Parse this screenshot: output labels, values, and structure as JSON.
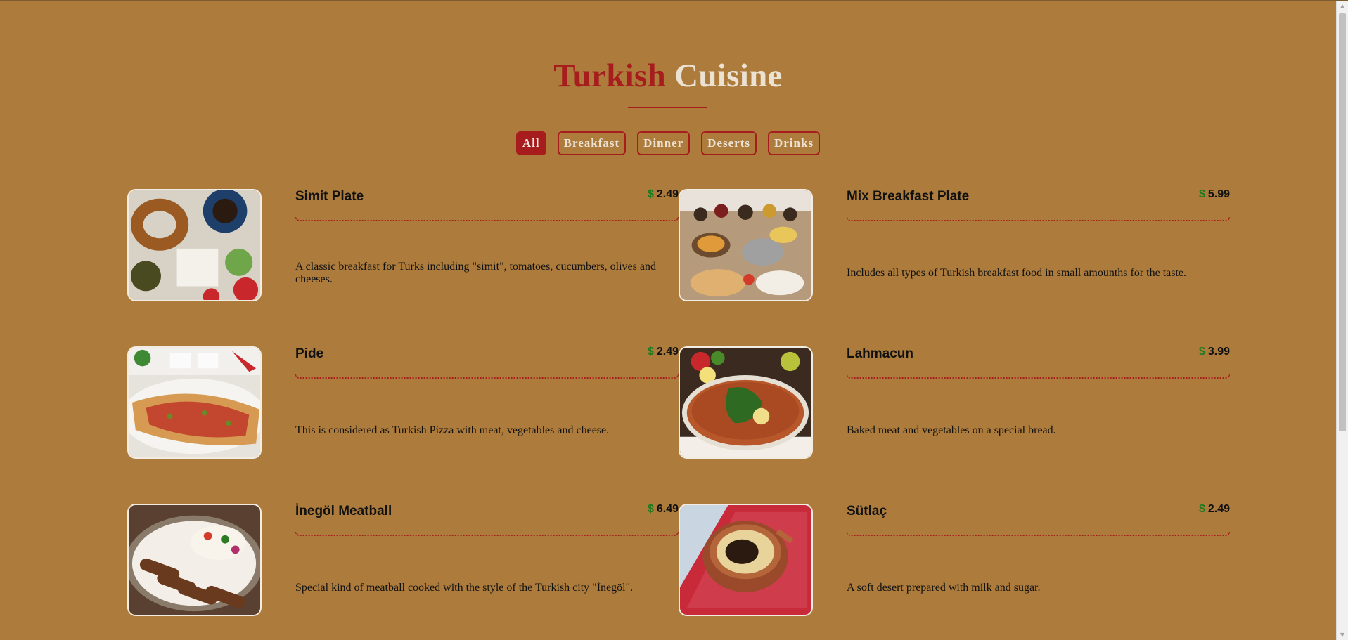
{
  "header": {
    "title_part1": "Turkish",
    "title_part2": "Cuisine"
  },
  "filters": [
    {
      "label": "All",
      "active": true
    },
    {
      "label": "Breakfast",
      "active": false
    },
    {
      "label": "Dinner",
      "active": false
    },
    {
      "label": "Deserts",
      "active": false
    },
    {
      "label": "Drinks",
      "active": false
    }
  ],
  "currency_symbol": "$",
  "items": [
    {
      "name": "Simit Plate",
      "price": "2.49",
      "description": "A classic breakfast for Turks including \"simit\", tomatoes, cucumbers, olives and cheeses.",
      "image": "simit-plate-photo"
    },
    {
      "name": "Mix Breakfast Plate",
      "price": "5.99",
      "description": "Includes all types of Turkish breakfast food in small amounths for the taste.",
      "image": "mix-breakfast-photo"
    },
    {
      "name": "Pide",
      "price": "2.49",
      "description": "This is considered as Turkish Pizza with meat, vegetables and cheese.",
      "image": "pide-photo"
    },
    {
      "name": "Lahmacun",
      "price": "3.99",
      "description": "Baked meat and vegetables on a special bread.",
      "image": "lahmacun-photo"
    },
    {
      "name": "İnegöl Meatball",
      "price": "6.49",
      "description": "Special kind of meatball cooked with the style of the Turkish city \"İnegöl\".",
      "image": "inegol-meatball-photo"
    },
    {
      "name": "Sütlaç",
      "price": "2.49",
      "description": "A soft desert prepared with milk and sugar.",
      "image": "sutlac-photo"
    }
  ],
  "colors": {
    "background": "#ad7c3c",
    "accent": "#a71d1d",
    "light": "#ece2d4",
    "price_symbol": "#1e7a1e"
  }
}
